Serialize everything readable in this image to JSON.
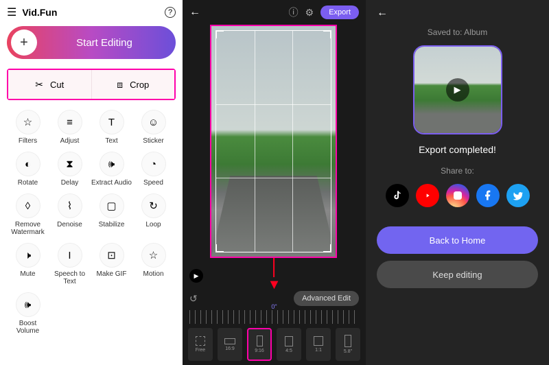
{
  "panel1": {
    "app_name": "Vid.Fun",
    "start_editing": "Start Editing",
    "cut": "Cut",
    "crop": "Crop",
    "tools": [
      {
        "label": "Filters"
      },
      {
        "label": "Adjust"
      },
      {
        "label": "Text"
      },
      {
        "label": "Sticker"
      },
      {
        "label": "Rotate"
      },
      {
        "label": "Delay"
      },
      {
        "label": "Extract Audio"
      },
      {
        "label": "Speed"
      },
      {
        "label": "Remove Watermark"
      },
      {
        "label": "Denoise"
      },
      {
        "label": "Stabilize"
      },
      {
        "label": "Loop"
      },
      {
        "label": "Mute"
      },
      {
        "label": "Speech to Text"
      },
      {
        "label": "Make GIF"
      },
      {
        "label": "Motion"
      },
      {
        "label": "Boost Volume"
      }
    ]
  },
  "panel2": {
    "export": "Export",
    "advanced_edit": "Advanced Edit",
    "time_marker": "0\"",
    "ratios": [
      {
        "label": "Free"
      },
      {
        "label": "16:9"
      },
      {
        "label": "9:16"
      },
      {
        "label": "4:5"
      },
      {
        "label": "1:1"
      },
      {
        "label": "5.8\""
      }
    ]
  },
  "panel3": {
    "saved_to": "Saved to: Album",
    "completed": "Export completed!",
    "share_to": "Share to:",
    "back_home": "Back to Home",
    "keep_editing": "Keep editing"
  }
}
